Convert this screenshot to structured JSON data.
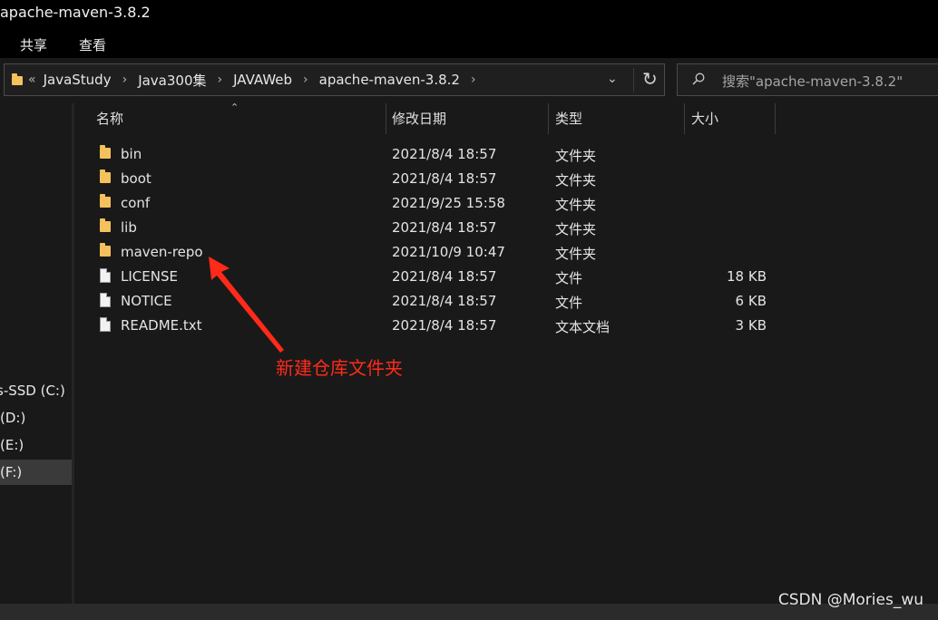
{
  "window": {
    "title": "apache-maven-3.8.2"
  },
  "ribbon": {
    "tabs": [
      "共享",
      "查看"
    ]
  },
  "address": {
    "overflow": "«",
    "crumbs": [
      "JavaStudy",
      "Java300集",
      "JAVAWeb",
      "apache-maven-3.8.2"
    ],
    "separator": "›"
  },
  "search": {
    "placeholder": "搜索\"apache-maven-3.8.2\""
  },
  "nav": {
    "drives": [
      {
        "label": "s-SSD (C:)",
        "selected": false
      },
      {
        "label": "(D:)",
        "selected": false
      },
      {
        "label": "(E:)",
        "selected": false
      },
      {
        "label": "(F:)",
        "selected": true
      }
    ]
  },
  "columns": {
    "name": "名称",
    "modified": "修改日期",
    "type": "类型",
    "size": "大小"
  },
  "files": [
    {
      "name": "bin",
      "modified": "2021/8/4 18:57",
      "type": "文件夹",
      "size": "",
      "icon": "folder-icon"
    },
    {
      "name": "boot",
      "modified": "2021/8/4 18:57",
      "type": "文件夹",
      "size": "",
      "icon": "folder-icon"
    },
    {
      "name": "conf",
      "modified": "2021/9/25 15:58",
      "type": "文件夹",
      "size": "",
      "icon": "folder-icon"
    },
    {
      "name": "lib",
      "modified": "2021/8/4 18:57",
      "type": "文件夹",
      "size": "",
      "icon": "folder-icon"
    },
    {
      "name": "maven-repo",
      "modified": "2021/10/9 10:47",
      "type": "文件夹",
      "size": "",
      "icon": "folder-icon"
    },
    {
      "name": "LICENSE",
      "modified": "2021/8/4 18:57",
      "type": "文件",
      "size": "18 KB",
      "icon": "file-icon"
    },
    {
      "name": "NOTICE",
      "modified": "2021/8/4 18:57",
      "type": "文件",
      "size": "6 KB",
      "icon": "file-icon"
    },
    {
      "name": "README.txt",
      "modified": "2021/8/4 18:57",
      "type": "文本文档",
      "size": "3 KB",
      "icon": "file-icon"
    }
  ],
  "annotation": {
    "text": "新建仓库文件夹",
    "color": "#ff2a1a"
  },
  "watermark": "CSDN @Mories_wu",
  "colors": {
    "folder": "#f5c15c",
    "background": "#191919",
    "selected": "#3a3a3a"
  }
}
